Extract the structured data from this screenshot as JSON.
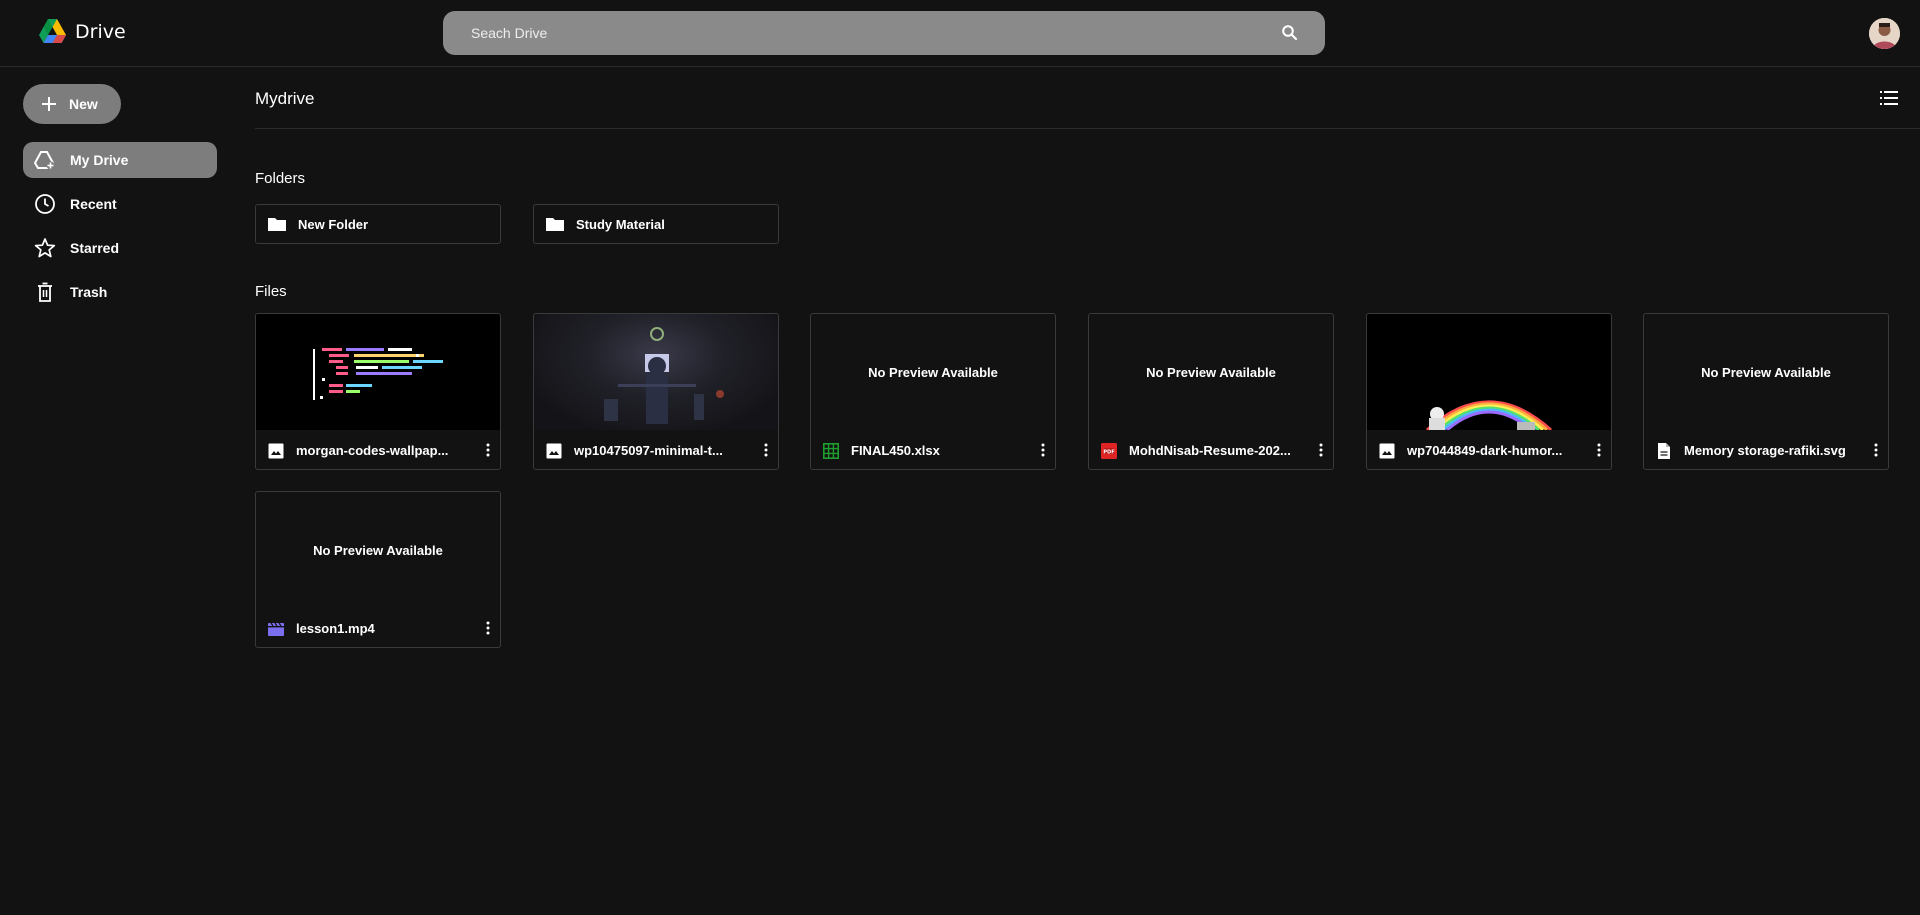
{
  "app": {
    "name": "Drive"
  },
  "search": {
    "placeholder": "Seach Drive"
  },
  "sidebar": {
    "new_label": "New",
    "items": [
      {
        "label": "My Drive",
        "icon": "drive-icon",
        "active": true
      },
      {
        "label": "Recent",
        "icon": "clock-icon"
      },
      {
        "label": "Starred",
        "icon": "star-icon"
      },
      {
        "label": "Trash",
        "icon": "trash-icon"
      }
    ]
  },
  "main": {
    "title": "Mydrive",
    "folders_heading": "Folders",
    "files_heading": "Files",
    "folders": [
      {
        "name": "New Folder"
      },
      {
        "name": "Study Material"
      }
    ],
    "no_preview_text": "No Preview Available",
    "files": [
      {
        "name": "morgan-codes-wallpap...",
        "type": "image"
      },
      {
        "name": "wp10475097-minimal-t...",
        "type": "image"
      },
      {
        "name": "FINAL450.xlsx",
        "type": "spreadsheet"
      },
      {
        "name": "MohdNisab-Resume-202...",
        "type": "pdf"
      },
      {
        "name": "wp7044849-dark-humor...",
        "type": "image"
      },
      {
        "name": "Memory storage-rafiki.svg",
        "type": "document"
      },
      {
        "name": "lesson1.mp4",
        "type": "video"
      }
    ]
  },
  "colors": {
    "background": "#121212",
    "accent_gray": "#7d7d7d",
    "search_bg": "#8a8a8a",
    "xlsx_green": "#1e9e2e",
    "pdf_red": "#e02424",
    "video_purple": "#7b6ff0"
  }
}
